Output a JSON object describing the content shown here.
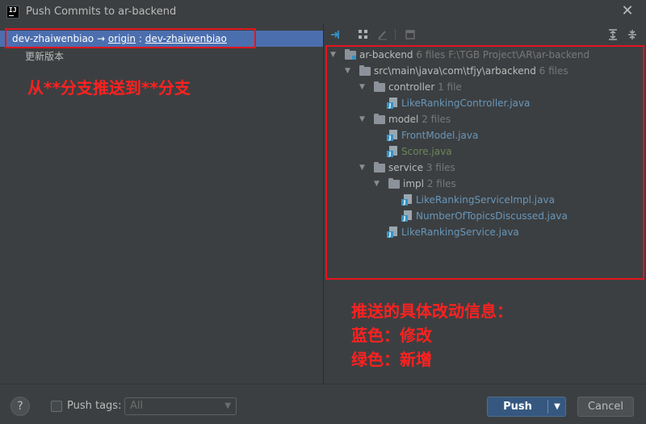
{
  "window": {
    "title": "Push Commits to ar-backend",
    "app_icon_text": "IJ"
  },
  "left": {
    "branch": {
      "local": "dev-zhaiwenbiao",
      "arrow": "→",
      "remote": "origin",
      "sep": ":",
      "remote_branch": "dev-zhaiwenbiao"
    },
    "commits": [
      "更新版本"
    ],
    "annotation": "从**分支推送到**分支"
  },
  "tree": {
    "rows": [
      {
        "name": "ar-backend",
        "count": "6 files",
        "path": "F:\\TGB Project\\AR\\ar-backend",
        "kind": "module"
      },
      {
        "name": "src\\main\\java\\com\\tfjy\\arbackend",
        "count": "6 files",
        "kind": "folder"
      },
      {
        "name": "controller",
        "count": "1 file",
        "kind": "folder"
      },
      {
        "name": "LikeRankingController.java",
        "kind": "file",
        "status": "modified"
      },
      {
        "name": "model",
        "count": "2 files",
        "kind": "folder"
      },
      {
        "name": "FrontModel.java",
        "kind": "file",
        "status": "modified"
      },
      {
        "name": "Score.java",
        "kind": "file",
        "status": "added"
      },
      {
        "name": "service",
        "count": "3 files",
        "kind": "folder"
      },
      {
        "name": "impl",
        "count": "2 files",
        "kind": "folder"
      },
      {
        "name": "LikeRankingServiceImpl.java",
        "kind": "file",
        "status": "modified"
      },
      {
        "name": "NumberOfTopicsDiscussed.java",
        "kind": "file",
        "status": "modified"
      },
      {
        "name": "LikeRankingService.java",
        "kind": "file",
        "status": "modified"
      }
    ],
    "annotation": [
      "推送的具体改动信息：",
      "蓝色：修改",
      "绿色：新增"
    ]
  },
  "footer": {
    "help": "?",
    "push_tags_label": "Push tags:",
    "push_tags_value": "All",
    "push_label": "Push",
    "cancel_label": "Cancel"
  },
  "colors": {
    "modified": "#6897bb",
    "added": "#6a8759",
    "selection": "#4b6eaf",
    "annotation": "#ff2121"
  }
}
